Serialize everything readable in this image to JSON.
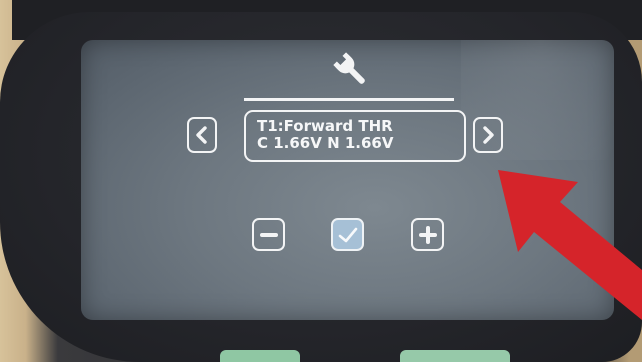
{
  "screen": {
    "header_icon": "wrench-icon",
    "parameter": {
      "title": "T1:Forward THR",
      "values": "C 1.66V  N 1.66V"
    },
    "buttons": {
      "previous_icon": "chevron-left-icon",
      "next_icon": "chevron-right-icon",
      "decrease_icon": "minus-icon",
      "confirm_icon": "checkmark-icon",
      "increase_icon": "plus-icon"
    }
  },
  "annotation": {
    "pointer": "red-arrow",
    "color": "#d5242a"
  },
  "colors": {
    "screen_background": "#6d7780",
    "foreground": "#f3f4f5",
    "confirm_fill": "#a6c0d6"
  }
}
